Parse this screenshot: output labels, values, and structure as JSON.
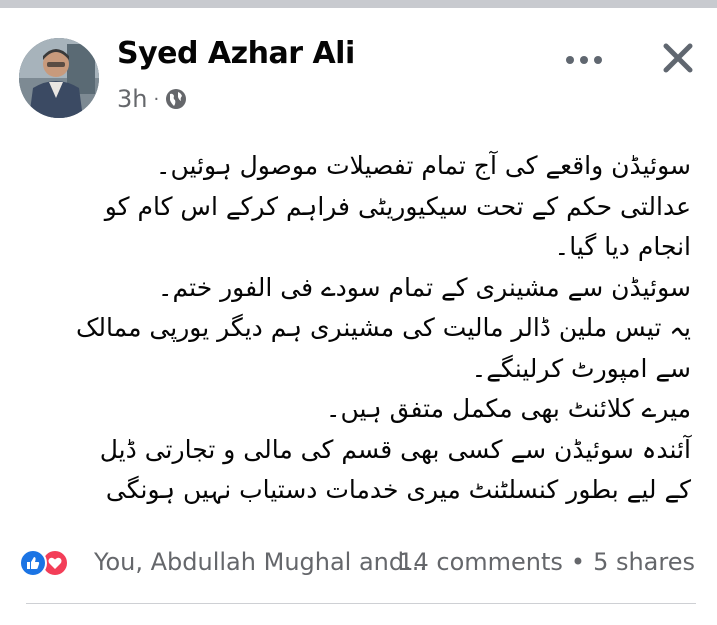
{
  "post": {
    "author": "Syed Azhar Ali",
    "time": "3h",
    "separator": "·",
    "privacy_icon": "globe-icon",
    "menu_icon": "more-options-icon",
    "close_icon": "close-icon",
    "body_lines": [
      "سوئیڈن واقعے کی آج تمام تفصیلات موصول ہوئیں۔",
      "عدالتی حکم کے تحت سیکیوریٹی فراہم کرکے اس کام کو",
      "انجام دیا گیا۔",
      "سوئیڈن سے مشینری کے تمام سودے فی الفور ختم۔",
      "یہ تیس ملین ڈالر مالیت کی مشینری ہم دیگر یورپی ممالک",
      "سے امپورٹ کرلینگے۔",
      "میرے کلائنٹ بھی مکمل متفق ہیں۔",
      "آئندہ سوئیڈن سے کسی بھی قسم کی مالی و تجارتی ڈیل",
      "کے لیے بطور کنسلٹنٹ میری خدمات دستیاب نہیں ہونگی"
    ]
  },
  "footer": {
    "reaction_icons": [
      "like-icon",
      "love-icon"
    ],
    "reactors": "You, Abdullah Mughal and...",
    "comments": "14 comments",
    "dot": "•",
    "shares": "5 shares"
  },
  "colors": {
    "text": "#050505",
    "secondary": "#65676b",
    "like": "#1b74e4",
    "love": "#f33e58"
  }
}
